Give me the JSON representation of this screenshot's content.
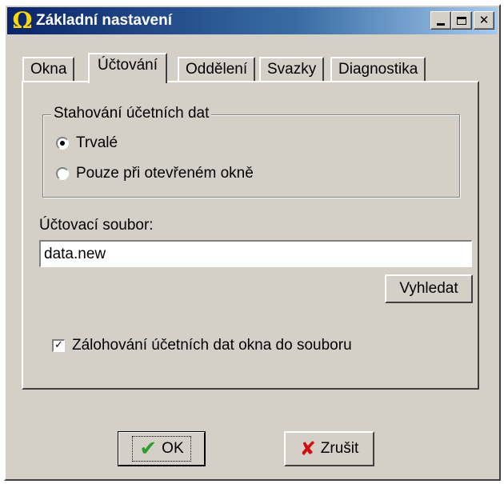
{
  "window": {
    "title": "Základní nastavení",
    "icon": "omega-icon",
    "icon_glyph": "Ω",
    "controls": [
      "minimize",
      "maximize",
      "close"
    ]
  },
  "tabs": [
    {
      "label": "Okna",
      "active": false
    },
    {
      "label": "Účtování",
      "active": true
    },
    {
      "label": "Oddělení",
      "active": false
    },
    {
      "label": "Svazky",
      "active": false
    },
    {
      "label": "Diagnostika",
      "active": false
    }
  ],
  "download_group": {
    "title": "Stahování účetních dat",
    "options": [
      {
        "label": "Trvalé",
        "selected": true
      },
      {
        "label": "Pouze při otevřeném okně",
        "selected": false
      }
    ]
  },
  "billing_file": {
    "label": "Účtovací soubor:",
    "value": "data.new",
    "browse_label": "Vyhledat"
  },
  "backup_checkbox": {
    "label": "Zálohování účetních dat okna do souboru",
    "checked": true
  },
  "buttons": {
    "ok_label": "OK",
    "cancel_label": "Zrušit"
  },
  "colors": {
    "face": "#d4d0c8",
    "title_start": "#0a246a",
    "title_end": "#a6caf0",
    "ok_icon": "#2e9e2e",
    "cancel_icon": "#d01010",
    "app_icon": "#ffd800"
  }
}
